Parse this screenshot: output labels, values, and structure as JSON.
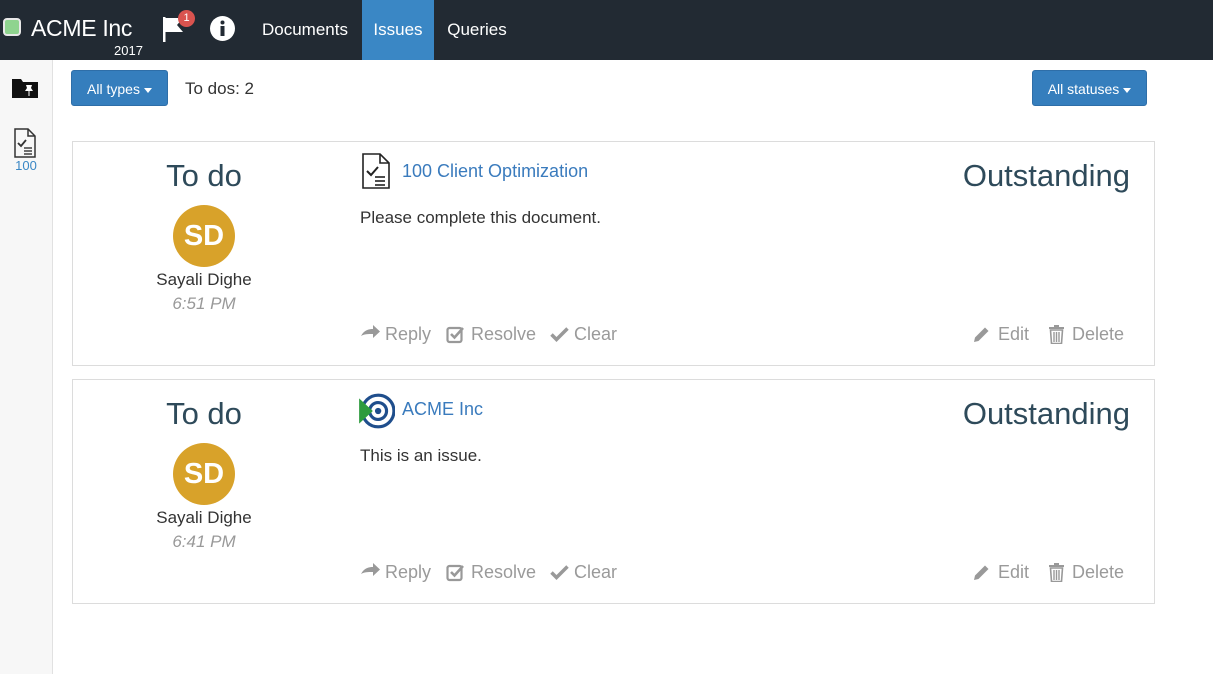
{
  "app": {
    "name": "ACME Inc",
    "year": "2017",
    "notification_count": "1"
  },
  "nav": {
    "tabs": [
      {
        "label": "Documents"
      },
      {
        "label": "Issues"
      },
      {
        "label": "Queries"
      }
    ]
  },
  "sidebar": {
    "doc_count": "100"
  },
  "toolbar": {
    "types_filter": "All types",
    "todo_count": "To dos: 2",
    "status_filter": "All statuses"
  },
  "issues": [
    {
      "type": "To do",
      "initials": "SD",
      "author": "Sayali Dighe",
      "time": "6:51 PM",
      "reference": "100 Client Optimization",
      "message": "Please complete this document.",
      "status": "Outstanding"
    },
    {
      "type": "To do",
      "initials": "SD",
      "author": "Sayali Dighe",
      "time": "6:41 PM",
      "reference": "ACME Inc",
      "message": "This is an issue.",
      "status": "Outstanding"
    }
  ],
  "actions": {
    "reply": "Reply",
    "resolve": "Resolve",
    "clear": "Clear",
    "edit": "Edit",
    "delete": "Delete"
  },
  "colors": {
    "navbar": "#222a33",
    "active_tab": "#3a87c5",
    "button": "#357ebd",
    "avatar": "#d8a22a",
    "link": "#3a7bbd"
  }
}
